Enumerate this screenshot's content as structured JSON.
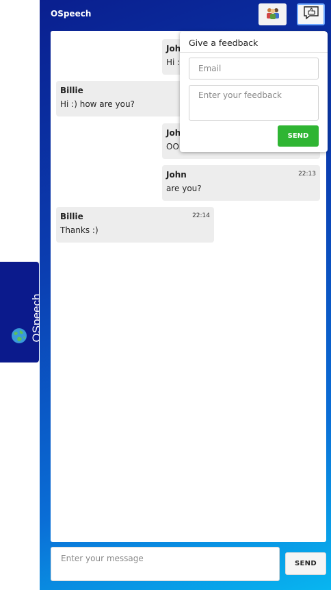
{
  "app": {
    "title": "OSpeech"
  },
  "side_tab": {
    "label": "OSpeech",
    "icon": "globe-icon"
  },
  "header": {
    "users_icon": "users-icon",
    "feedback_icon": "thumbs-up-chat-icon"
  },
  "messages": [
    {
      "author": "John",
      "time": "",
      "text": "Hi :"
    },
    {
      "author": "Billie",
      "time": "",
      "text": "Hi :) how are you?"
    },
    {
      "author": "Joh",
      "time": "",
      "text": "OO"
    },
    {
      "author": "John",
      "time": "22:13",
      "text": "are you?"
    },
    {
      "author": "Billie",
      "time": "22:14",
      "text": "Thanks :)"
    }
  ],
  "composer": {
    "placeholder": "Enter your message",
    "send_label": "SEND"
  },
  "feedback": {
    "title": "Give a feedback",
    "email_placeholder": "Email",
    "feedback_placeholder": "Enter your feedback",
    "send_label": "SEND"
  },
  "colors": {
    "panel_start": "#0a1f8f",
    "panel_end": "#08b6f0",
    "send_green": "#2fb533",
    "message_bg": "#ededed"
  }
}
